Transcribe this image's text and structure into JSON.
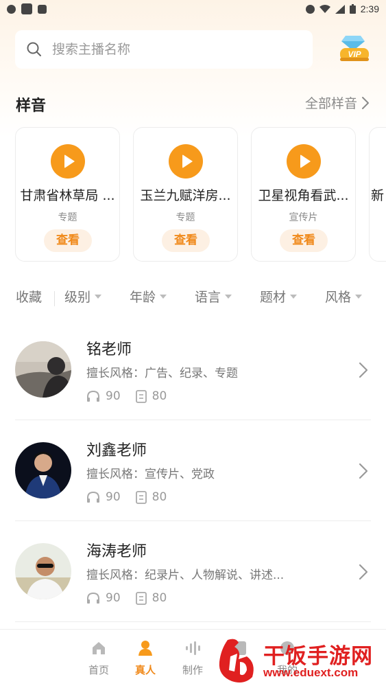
{
  "status_bar": {
    "time": "2:39"
  },
  "search": {
    "placeholder": "搜索主播名称"
  },
  "vip": {
    "label": "VIP"
  },
  "samples": {
    "title": "样音",
    "all_label": "全部样音",
    "cards": [
      {
        "title": "甘肃省林草局 ...",
        "type": "专题",
        "action": "查看"
      },
      {
        "title": "玉兰九赋洋房...",
        "type": "专题",
        "action": "查看"
      },
      {
        "title": "卫星视角看武...",
        "type": "宣传片",
        "action": "查看"
      },
      {
        "title": "新",
        "type": "",
        "action": ""
      }
    ]
  },
  "filters": {
    "favorites": "收藏",
    "items": [
      "级别",
      "年龄",
      "语言",
      "题材",
      "风格"
    ]
  },
  "teachers": [
    {
      "name": "铭老师",
      "style": "擅长风格：广告、纪录、专题",
      "listens": "90",
      "works": "80"
    },
    {
      "name": "刘鑫老师",
      "style": "擅长风格：宣传片、党政",
      "listens": "90",
      "works": "80"
    },
    {
      "name": "海涛老师",
      "style": "擅长风格：纪录片、人物解说、讲述...",
      "listens": "90",
      "works": "80"
    }
  ],
  "bottom_nav": [
    {
      "label": "首页",
      "icon": "home-icon",
      "active": false
    },
    {
      "label": "真人",
      "icon": "person-icon",
      "active": true
    },
    {
      "label": "制作",
      "icon": "waveform-icon",
      "active": false
    },
    {
      "label": "作品",
      "icon": "works-icon",
      "active": false
    },
    {
      "label": "我的",
      "icon": "profile-icon",
      "active": false
    }
  ],
  "watermark": {
    "title": "干饭手游网",
    "url": "www.eduext.com"
  },
  "colors": {
    "accent": "#f79a1b",
    "accent_text": "#f08a1c",
    "watermark": "#e02020"
  }
}
